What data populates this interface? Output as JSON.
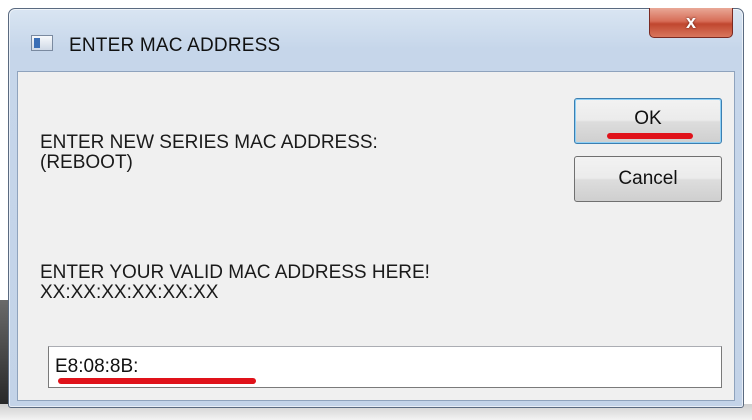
{
  "window": {
    "title": "ENTER MAC ADDRESS",
    "close_label": "x"
  },
  "dialog": {
    "prompt_line1": "ENTER NEW SERIES MAC ADDRESS:",
    "prompt_line2": "(REBOOT)",
    "hint_line1": "ENTER YOUR VALID MAC ADDRESS HERE!",
    "hint_line2": "XX:XX:XX:XX:XX:XX"
  },
  "buttons": {
    "ok_label": "OK",
    "cancel_label": "Cancel"
  },
  "mac_field": {
    "value": "E8:08:8B:"
  },
  "colors": {
    "annotation_red": "#e0121a",
    "close_button": "#c94a34",
    "title_bar": "#c6d6ea"
  },
  "icons": {
    "app": "window-app-icon",
    "close": "close-icon"
  }
}
